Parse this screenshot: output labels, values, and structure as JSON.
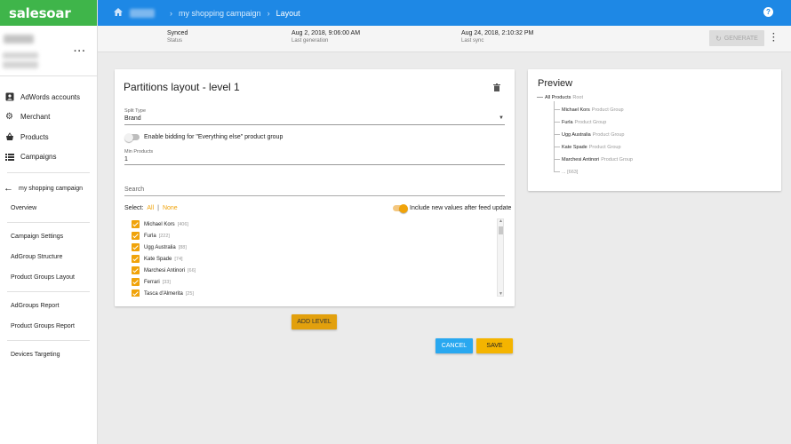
{
  "app": {
    "logo": "salesoar"
  },
  "topbar": {
    "crumbs": [
      "my shopping campaign",
      "Layout"
    ],
    "help": "?"
  },
  "status": {
    "items": [
      {
        "value": "Synced",
        "label": "Status"
      },
      {
        "value": "Aug 2, 2018, 9:06:00 AM",
        "label": "Last generation"
      },
      {
        "value": "Aug 24, 2018, 2:10:32 PM",
        "label": "Last sync"
      }
    ],
    "generate": "GENERATE"
  },
  "sidebar": {
    "menu": [
      {
        "label": "AdWords accounts",
        "icon": "account-box-icon"
      },
      {
        "label": "Merchant",
        "icon": "gear-icon"
      },
      {
        "label": "Products",
        "icon": "basket-icon"
      },
      {
        "label": "Campaigns",
        "icon": "list-icon"
      }
    ],
    "campaign": "my shopping campaign",
    "sub_groups": [
      [
        "Overview"
      ],
      [
        "Campaign Settings",
        "AdGroup Structure",
        "Product Groups Layout"
      ],
      [
        "AdGroups Report",
        "Product Groups Report"
      ],
      [
        "Devices Targeting"
      ]
    ]
  },
  "partitions": {
    "title": "Partitions layout - level 1",
    "split_type": {
      "label": "Split Type",
      "value": "Brand"
    },
    "enable_bidding": "Enable bidding for \"Everything else\" product group",
    "min_products": {
      "label": "Min Products",
      "value": "1"
    },
    "search_placeholder": "Search",
    "select_label": "Select:",
    "select_all": "All",
    "select_sep": "|",
    "select_none": "None",
    "include_new": "Include new values after feed update",
    "values": [
      {
        "name": "Michael Kors",
        "count": "[406]"
      },
      {
        "name": "Furla",
        "count": "[222]"
      },
      {
        "name": "Ugg Australia",
        "count": "[88]"
      },
      {
        "name": "Kate Spade",
        "count": "[74]"
      },
      {
        "name": "Marchesi Antinori",
        "count": "[66]"
      },
      {
        "name": "Ferrari",
        "count": "[33]"
      },
      {
        "name": "Tasca d'Almerita",
        "count": "[25]"
      }
    ]
  },
  "buttons": {
    "add_level": "ADD LEVEL",
    "cancel": "CANCEL",
    "save": "SAVE"
  },
  "preview": {
    "title": "Preview",
    "root": {
      "name": "All Products",
      "tag": "Root"
    },
    "nodes": [
      {
        "name": "Michael Kors",
        "tag": "Product Group"
      },
      {
        "name": "Furla",
        "tag": "Product Group"
      },
      {
        "name": "Ugg Australia",
        "tag": "Product Group"
      },
      {
        "name": "Kate Spade",
        "tag": "Product Group"
      },
      {
        "name": "Marchesi Antinori",
        "tag": "Product Group"
      }
    ],
    "more": "... [663]"
  }
}
